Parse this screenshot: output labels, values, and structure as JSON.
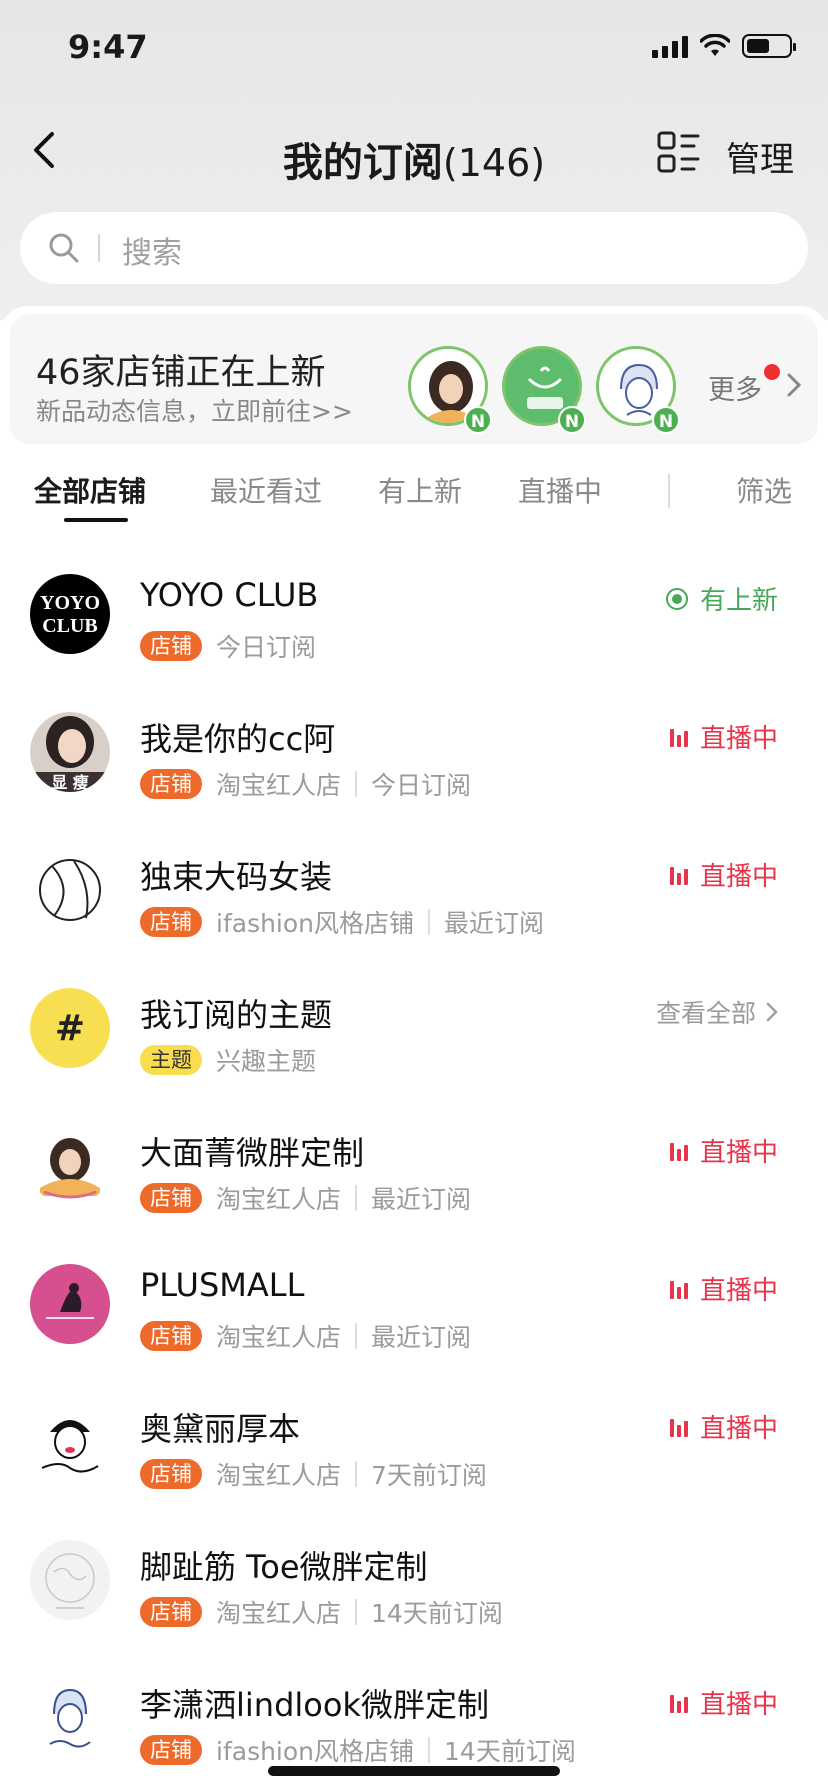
{
  "status_bar": {
    "time": "9:47",
    "battery_level": 0.55
  },
  "header": {
    "title": "我的订阅",
    "count": "(146)",
    "manage_label": "管理"
  },
  "search": {
    "placeholder": "搜索"
  },
  "promo": {
    "title": "46家店铺正在上新",
    "subtitle": "新品动态信息，立即前往>>",
    "badge": "N",
    "more_label": "更多"
  },
  "tabs": [
    "全部店铺",
    "最近看过",
    "有上新",
    "直播中",
    "筛选"
  ],
  "list": [
    {
      "name": "YOYO CLUB",
      "tag": "店铺",
      "meta": [
        "今日订阅"
      ],
      "status": "有上新",
      "status_type": "new",
      "avatar_icon": "yoyo-club-logo",
      "avatar_text": "YOYO CLUB"
    },
    {
      "name": "我是你的cc阿",
      "tag": "店铺",
      "meta": [
        "淘宝红人店",
        "今日订阅"
      ],
      "status": "直播中",
      "status_type": "live",
      "avatar_icon": "portrait-avatar",
      "avatar_text": "显 瘦"
    },
    {
      "name": "独束大码女装",
      "tag": "店铺",
      "meta": [
        "ifashion风格店铺",
        "最近订阅"
      ],
      "status": "直播中",
      "status_type": "live",
      "avatar_icon": "ball-line-logo"
    },
    {
      "name": "我订阅的主题",
      "tag": "主题",
      "meta": [
        "兴趣主题"
      ],
      "status": "查看全部",
      "status_type": "more",
      "avatar_icon": "hashtag-icon",
      "avatar_text": "#"
    },
    {
      "name": "大面菁微胖定制",
      "tag": "店铺",
      "meta": [
        "淘宝红人店",
        "最近订阅"
      ],
      "status": "直播中",
      "status_type": "live",
      "avatar_icon": "illustrated-girl-logo"
    },
    {
      "name": "PLUSMALL",
      "tag": "店铺",
      "meta": [
        "淘宝红人店",
        "最近订阅"
      ],
      "status": "直播中",
      "status_type": "live",
      "avatar_icon": "plusmall-logo"
    },
    {
      "name": "奥黛丽厚本",
      "tag": "店铺",
      "meta": [
        "淘宝红人店",
        "7天前订阅"
      ],
      "status": "直播中",
      "status_type": "live",
      "avatar_icon": "sketch-face-logo"
    },
    {
      "name": "脚趾筋 Toe微胖定制",
      "tag": "店铺",
      "meta": [
        "淘宝红人店",
        "14天前订阅"
      ],
      "status": "",
      "status_type": "none",
      "avatar_icon": "map-circle-logo"
    },
    {
      "name": "李潇洒lindlook微胖定制",
      "tag": "店铺",
      "meta": [
        "ifashion风格店铺",
        "14天前订阅"
      ],
      "status": "直播中",
      "status_type": "live",
      "avatar_icon": "lindlook-logo"
    }
  ],
  "colors": {
    "live": "#e8344b",
    "new": "#45a956",
    "tag": "#ee6a2a",
    "topic_tag": "#f8dd4e"
  }
}
